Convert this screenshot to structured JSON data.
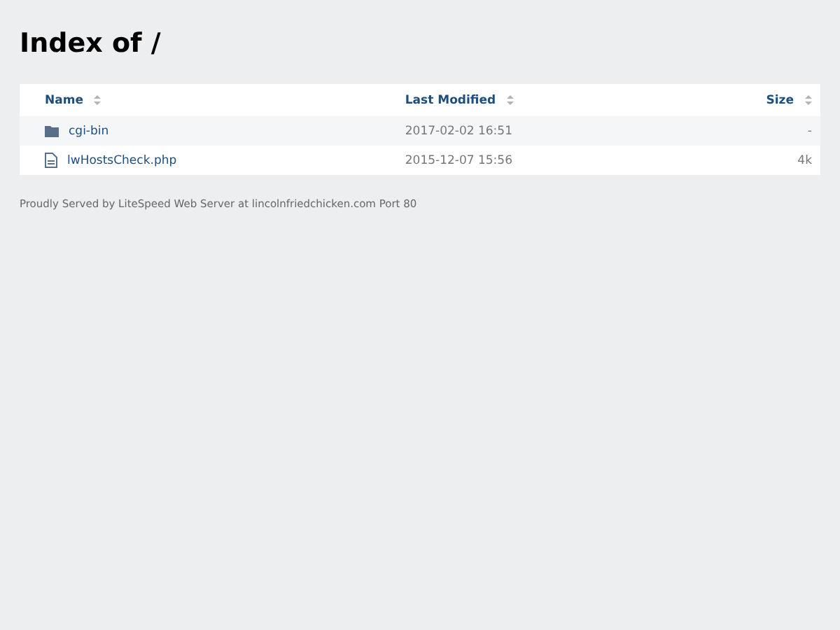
{
  "title": "Index of /",
  "table": {
    "columns": [
      {
        "label": "Name"
      },
      {
        "label": "Last Modified"
      },
      {
        "label": "Size"
      }
    ],
    "rows": [
      {
        "kind": "folder",
        "name": "cgi-bin",
        "modified": "2017-02-02 16:51",
        "size": "-"
      },
      {
        "kind": "file",
        "name": "lwHostsCheck.php",
        "modified": "2015-12-07 15:56",
        "size": "4k"
      }
    ]
  },
  "footer": "Proudly Served by LiteSpeed Web Server at lincolnfriedchicken.com Port 80"
}
